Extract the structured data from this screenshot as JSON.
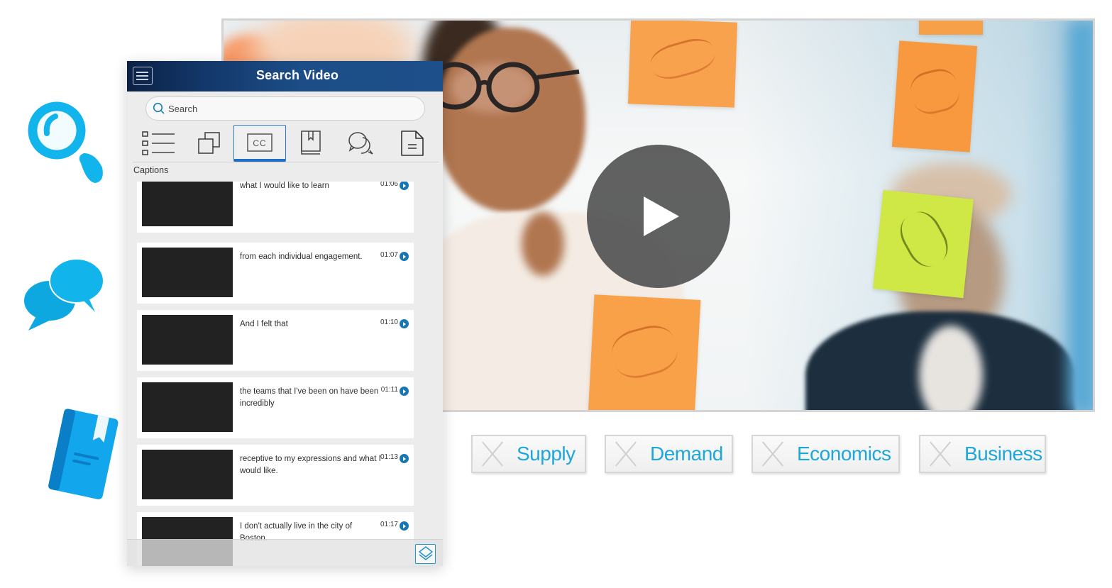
{
  "panel": {
    "title": "Search Video",
    "search": {
      "placeholder": "Search",
      "value": ""
    },
    "toolbar": [
      {
        "name": "list-view",
        "icon": "list-icon",
        "active": false
      },
      {
        "name": "clips",
        "icon": "copy-icon",
        "active": false
      },
      {
        "name": "captions",
        "icon": "closed-captions-icon",
        "label": "CC",
        "active": true
      },
      {
        "name": "bookmarks",
        "icon": "bookmark-book-icon",
        "active": false
      },
      {
        "name": "comments",
        "icon": "chat-bubbles-icon",
        "active": false
      },
      {
        "name": "notes",
        "icon": "document-icon",
        "active": false
      }
    ],
    "section_label": "Captions",
    "captions": [
      {
        "text": "what I would like to learn",
        "time": "01:06",
        "thumb": "men-meeting"
      },
      {
        "text": "from each individual engagement.",
        "time": "01:07",
        "thumb": "men-meeting"
      },
      {
        "text": "And I felt that",
        "time": "01:10",
        "thumb": "woman-writing"
      },
      {
        "text": "the teams that I've been on have been incredibly",
        "time": "01:11",
        "thumb": "woman-writing"
      },
      {
        "text": "receptive to my expressions and what I would like.",
        "time": "01:13",
        "thumb": "man-speaking"
      },
      {
        "text": "I don't actually live in the city of Boston.",
        "time": "01:17",
        "thumb": "man-speaking"
      }
    ],
    "footer_button_icon": "layers-icon"
  },
  "video": {
    "state": "paused",
    "play_icon": "play-icon"
  },
  "tags": [
    {
      "label": "Supply"
    },
    {
      "label": "Demand"
    },
    {
      "label": "Economics"
    },
    {
      "label": "Business"
    }
  ],
  "decorations": [
    "magnifier-icon",
    "chat-bubbles-icon",
    "book-icon"
  ],
  "colors": {
    "header_dark": "#0c2145",
    "header_blue": "#1d4f8a",
    "accent_blue": "#1ea7da",
    "caption_play": "#1876b5",
    "active_tab": "#2b7ad0",
    "deco_blue": "#12b4ec"
  }
}
